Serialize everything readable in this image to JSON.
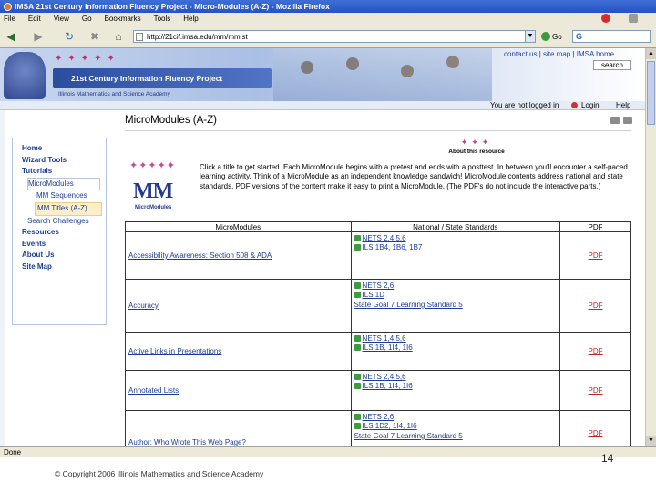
{
  "window": {
    "title": "IMSA 21st Century Information Fluency Project - Micro-Modules (A-Z) - Mozilla Firefox"
  },
  "menu": {
    "items": [
      "File",
      "Edit",
      "View",
      "Go",
      "Bookmarks",
      "Tools",
      "Help"
    ]
  },
  "nav": {
    "url": "http://21cif.imsa.edu/mm/mmist",
    "go_label": "Go",
    "search_value": "G"
  },
  "site": {
    "banner_title": "21st Century Information Fluency Project",
    "banner_sub": "Illinois Mathematics and Science Academy",
    "toplinks": [
      "contact us",
      "site map",
      "IMSA home"
    ],
    "search_button": "search",
    "login_status": "You are not logged in",
    "login_link": "Login",
    "help_link": "Help"
  },
  "sidebar": {
    "items": [
      {
        "label": "Home"
      },
      {
        "label": "Wizard Tools"
      },
      {
        "label": "Tutorials"
      },
      {
        "label": "MicroModules"
      },
      {
        "label": "MM Sequences"
      },
      {
        "label": "MM Titles (A-Z)"
      },
      {
        "label": "Search Challenges"
      },
      {
        "label": "Resources"
      },
      {
        "label": "Events"
      },
      {
        "label": "About Us"
      },
      {
        "label": "Site Map"
      }
    ]
  },
  "main": {
    "page_title": "MicroModules (A-Z)",
    "about_label": "About this resource",
    "logo_letters": "MM",
    "logo_label": "MicroModules",
    "intro": "Click a title to get started. Each MicroModule begins with a pretest and ends with a posttest. In between you'll encounter a self-paced learning activity. Think of a MicroModule as an independent knowledge sandwich! MicroModule contents address national and state standards. PDF versions of the content make it easy to print a MicroModule. (The PDF's do not include the interactive parts.)",
    "table": {
      "headers": [
        "MicroModules",
        "National / State Standards",
        "PDF"
      ],
      "rows": [
        {
          "title": "Accessibility Awareness: Section 508 & ADA",
          "standards": [
            "NETS 2,4,5,6",
            "ILS 1B4, 1B6, 1B7"
          ],
          "pdf": "PDF"
        },
        {
          "title": "Accuracy",
          "standards": [
            "NETS 2,6",
            "ILS 1D",
            "State Goal 7 Learning Standard 5"
          ],
          "pdf": "PDF"
        },
        {
          "title": "Active Links in Presentations",
          "standards": [
            "NETS 1,4,5,6",
            "ILS 1B, 1I4, 1I6"
          ],
          "pdf": "PDF"
        },
        {
          "title": "Annotated Lists",
          "standards": [
            "NETS 2,4,5,6",
            "ILS 1B, 1I4, 1I6"
          ],
          "pdf": "PDF"
        },
        {
          "title": "Author: Who Wrote This Web Page?",
          "standards": [
            "NETS 2,6",
            "ILS 1D2, 1I4, 1I6",
            "State Goal 7 Learning Standard 5"
          ],
          "pdf": "PDF"
        }
      ]
    }
  },
  "status": {
    "text": "Done"
  },
  "slide": {
    "number": "14",
    "copyright": "© Copyright 2006 Illinois Mathematics and Science Academy"
  }
}
